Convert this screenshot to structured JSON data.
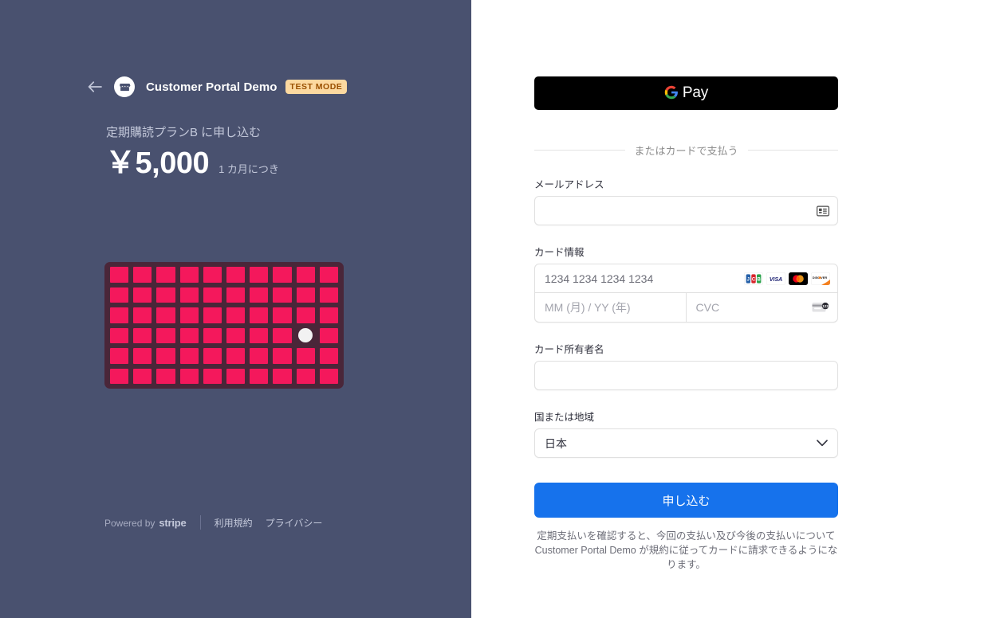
{
  "left_panel": {
    "back_icon": "back-arrow-icon",
    "merchant_logo_icon": "storefront-icon",
    "merchant_name": "Customer Portal Demo",
    "test_mode_badge": "TEST MODE",
    "plan_label": "定期購読プランB に申し込む",
    "price_amount": "￥5,000",
    "price_interval": "1 カ月につき",
    "product_image": {
      "alt": "pink-grid-pattern",
      "columns": 10,
      "rows": 6,
      "dot_row": 4,
      "dot_col": 9,
      "cell_color": "#f4185c",
      "bg_color": "#4a2639"
    },
    "footer": {
      "powered_by": "Powered by",
      "stripe_word": "stripe",
      "terms_link": "利用規約",
      "privacy_link": "プライバシー"
    },
    "bg_color": "#49516f"
  },
  "right_panel": {
    "gpay": {
      "label": "Pay",
      "icon": "google-g-icon",
      "bg_color": "#000000"
    },
    "divider_text": "またはカードで支払う",
    "email": {
      "label": "メールアドレス",
      "value": "",
      "placeholder": "",
      "autofill_icon": "contact-card-icon"
    },
    "card": {
      "label": "カード情報",
      "number_placeholder": "1234 1234 1234 1234",
      "number_value": "",
      "expiry_placeholder": "MM (月) / YY (年)",
      "expiry_value": "",
      "cvc_placeholder": "CVC",
      "cvc_value": "",
      "cvc_icon": "card-back-cvc-icon",
      "brands": [
        "JCB",
        "VISA",
        "Mastercard",
        "Discover"
      ]
    },
    "cardholder": {
      "label": "カード所有者名",
      "value": "",
      "placeholder": ""
    },
    "country": {
      "label": "国または地域",
      "selected": "日本",
      "chevron_icon": "chevron-down-icon"
    },
    "submit_label": "申し込む",
    "submit_color": "#1672ec",
    "terms_text": "定期支払いを確認すると、今回の支払い及び今後の支払いについて Customer Portal Demo が規約に従ってカードに請求できるようになります。"
  }
}
